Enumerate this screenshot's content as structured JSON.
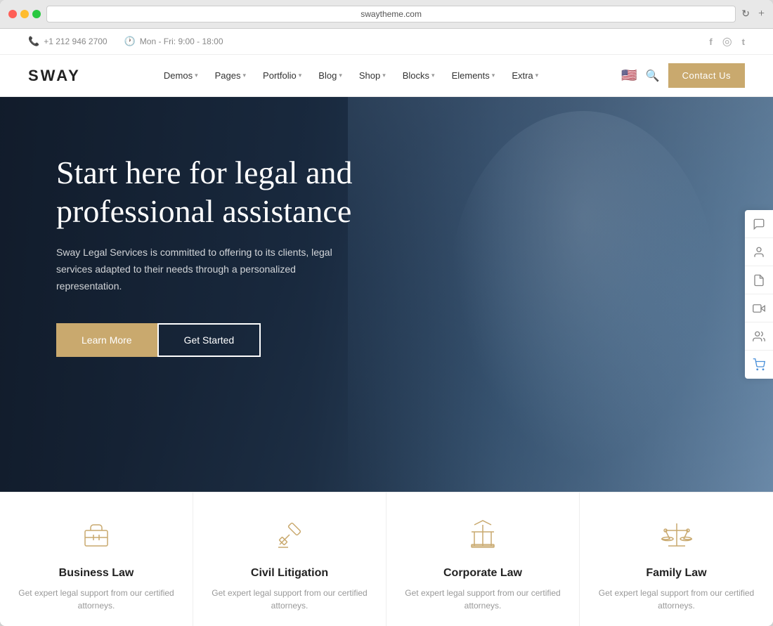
{
  "browser": {
    "url": "swaytheme.com",
    "refresh_icon": "↻",
    "new_tab_icon": "+"
  },
  "topbar": {
    "phone_icon": "📞",
    "phone": "+1 212 946 2700",
    "clock_icon": "🕐",
    "hours": "Mon - Fri: 9:00 - 18:00",
    "social": {
      "facebook": "f",
      "instagram": "◎",
      "twitter": "t"
    }
  },
  "navbar": {
    "logo": "SWAY",
    "menu_items": [
      {
        "label": "Demos",
        "has_dropdown": true
      },
      {
        "label": "Pages",
        "has_dropdown": true
      },
      {
        "label": "Portfolio",
        "has_dropdown": true
      },
      {
        "label": "Blog",
        "has_dropdown": true
      },
      {
        "label": "Shop",
        "has_dropdown": true
      },
      {
        "label": "Blocks",
        "has_dropdown": true
      },
      {
        "label": "Elements",
        "has_dropdown": true
      },
      {
        "label": "Extra",
        "has_dropdown": true
      }
    ],
    "flag": "🇺🇸",
    "search_icon": "🔍",
    "contact_btn": "Contact Us"
  },
  "hero": {
    "title": "Start here for legal and professional assistance",
    "subtitle": "Sway Legal Services is committed to offering to its clients, legal services adapted to their needs through a personalized representation.",
    "btn_learn_more": "Learn More",
    "btn_get_started": "Get Started"
  },
  "sidebar_icons": [
    {
      "name": "chat-icon",
      "symbol": "💬"
    },
    {
      "name": "user-circle-icon",
      "symbol": "👤"
    },
    {
      "name": "document-icon",
      "symbol": "📄"
    },
    {
      "name": "video-icon",
      "symbol": "🎥"
    },
    {
      "name": "contacts-icon",
      "symbol": "👥"
    },
    {
      "name": "cart-icon",
      "symbol": "🛒"
    }
  ],
  "services": [
    {
      "icon": "briefcase",
      "title": "Business Law",
      "desc": "Get expert legal support from our certified attorneys."
    },
    {
      "icon": "gavel",
      "title": "Civil Litigation",
      "desc": "Get expert legal support from our certified attorneys."
    },
    {
      "icon": "court",
      "title": "Corporate Law",
      "desc": "Get expert legal support from our certified attorneys."
    },
    {
      "icon": "scale",
      "title": "Family Law",
      "desc": "Get expert legal support from our certified attorneys."
    }
  ],
  "colors": {
    "gold": "#c9a96e",
    "dark": "#1a2332",
    "white": "#ffffff"
  }
}
